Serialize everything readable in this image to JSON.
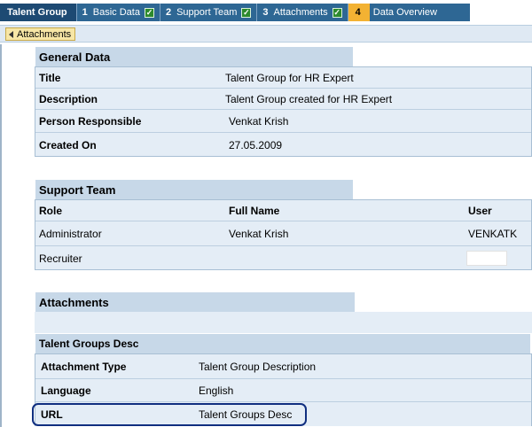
{
  "roadmap": {
    "start_label": "Talent Group",
    "steps": [
      {
        "num": "1",
        "label": "Basic Data",
        "done": true
      },
      {
        "num": "2",
        "label": "Support Team",
        "done": true
      },
      {
        "num": "3",
        "label": "Attachments",
        "done": true
      },
      {
        "num": "4",
        "label": "Data Overview",
        "current": true
      }
    ]
  },
  "back_button": {
    "label": "Attachments"
  },
  "general_data": {
    "title": "General Data",
    "rows": [
      {
        "label": "Title",
        "value": "Talent Group for HR Expert"
      },
      {
        "label": "Description",
        "value": "Talent Group created for HR Expert"
      },
      {
        "label": "Person Responsible",
        "value": "Venkat Krish"
      },
      {
        "label": "Created On",
        "value": "27.05.2009"
      }
    ]
  },
  "support_team": {
    "title": "Support Team",
    "columns": [
      "Role",
      "Full Name",
      "User"
    ],
    "rows": [
      {
        "role": "Administrator",
        "full_name": "Venkat Krish",
        "user": "VENKATK"
      },
      {
        "role": "Recruiter",
        "full_name": "",
        "user": ""
      }
    ]
  },
  "attachments": {
    "title": "Attachments",
    "subtitle": "Talent Groups Desc",
    "rows": [
      {
        "label": "Attachment Type",
        "value": "Talent Group Description"
      },
      {
        "label": "Language",
        "value": "English"
      },
      {
        "label": "URL",
        "value": "Talent Groups Desc"
      }
    ]
  }
}
